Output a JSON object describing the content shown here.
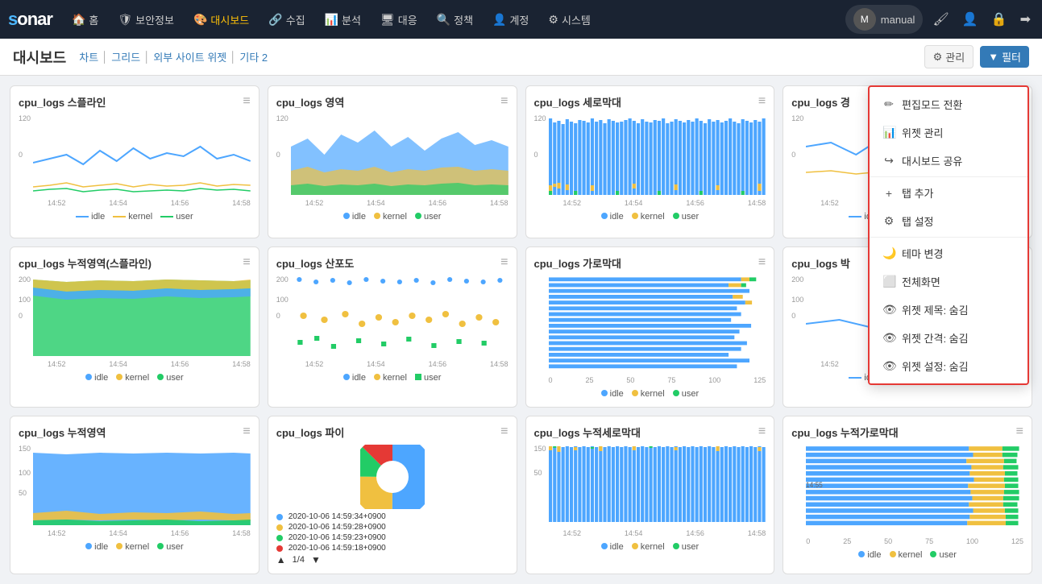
{
  "app": {
    "logo_s": "s",
    "logo_rest": "onar"
  },
  "nav": {
    "items": [
      {
        "id": "home",
        "icon": "🏠",
        "label": "홈"
      },
      {
        "id": "security",
        "icon": "🛡",
        "label": "보안정보"
      },
      {
        "id": "dashboard",
        "icon": "🎨",
        "label": "대시보드",
        "active": true
      },
      {
        "id": "collect",
        "icon": "🔗",
        "label": "수집"
      },
      {
        "id": "analysis",
        "icon": "📊",
        "label": "분석"
      },
      {
        "id": "response",
        "icon": "🖥",
        "label": "대응"
      },
      {
        "id": "policy",
        "icon": "🔍",
        "label": "정책"
      },
      {
        "id": "account",
        "icon": "👤",
        "label": "계정"
      },
      {
        "id": "system",
        "icon": "⚙",
        "label": "시스템"
      }
    ],
    "user": "manual"
  },
  "page": {
    "title": "대시보드",
    "tabs": [
      {
        "label": "차트",
        "id": "chart"
      },
      {
        "label": "그리드",
        "id": "grid"
      },
      {
        "label": "외부 사이트 위젯",
        "id": "external"
      },
      {
        "label": "기타 2",
        "id": "other"
      }
    ],
    "manage_label": "관리",
    "filter_label": "필터"
  },
  "dropdown": {
    "items": [
      {
        "icon": "✏",
        "label": "편집모드 전환",
        "id": "edit-mode"
      },
      {
        "icon": "📊",
        "label": "위젯 관리",
        "id": "widget-manage"
      },
      {
        "icon": "↪",
        "label": "대시보드 공유",
        "id": "dashboard-share"
      },
      {
        "divider": true
      },
      {
        "icon": "+",
        "label": "탭 추가",
        "id": "tab-add"
      },
      {
        "icon": "⚙",
        "label": "탭 설정",
        "id": "tab-settings"
      },
      {
        "divider": true
      },
      {
        "icon": "🌙",
        "label": "테마 변경",
        "id": "theme-change"
      },
      {
        "icon": "⬜",
        "label": "전체화면",
        "id": "fullscreen"
      },
      {
        "icon": "👁",
        "label": "위젯 제목: 숨김",
        "id": "widget-title-hide"
      },
      {
        "icon": "👁",
        "label": "위젯 간격: 숨김",
        "id": "widget-gap-hide"
      },
      {
        "icon": "👁",
        "label": "위젯 설정: 숨김",
        "id": "widget-setting-hide"
      }
    ]
  },
  "widgets": {
    "row1": [
      {
        "id": "w1",
        "title": "cpu_logs 스플라인",
        "type": "spline"
      },
      {
        "id": "w2",
        "title": "cpu_logs 영역",
        "type": "area"
      },
      {
        "id": "w3",
        "title": "cpu_logs 세로막대",
        "type": "bar"
      },
      {
        "id": "w4",
        "title": "cpu_logs 경",
        "type": "spline2",
        "partial": true
      }
    ],
    "row2": [
      {
        "id": "w5",
        "title": "cpu_logs 누적영역(스플라인)",
        "type": "stackedSpline"
      },
      {
        "id": "w6",
        "title": "cpu_logs 산포도",
        "type": "scatter"
      },
      {
        "id": "w7",
        "title": "cpu_logs 가로막대",
        "type": "hbar"
      },
      {
        "id": "w8",
        "title": "cpu_logs 박",
        "type": "spline3",
        "partial": true
      }
    ],
    "row3": [
      {
        "id": "w9",
        "title": "cpu_logs 누적영역",
        "type": "stackedArea"
      },
      {
        "id": "w10",
        "title": "cpu_logs 파이",
        "type": "pie"
      },
      {
        "id": "w11",
        "title": "cpu_logs 누적세로막대",
        "type": "stackedBar"
      },
      {
        "id": "w12",
        "title": "cpu_logs 누적가로막대",
        "type": "stackedHBar"
      }
    ]
  },
  "legend": {
    "idle_color": "#4da6ff",
    "kernel_color": "#f0c040",
    "user_color": "#22cc66",
    "idle_label": "idle",
    "kernel_label": "kernel",
    "user_label": "user"
  },
  "xaxis": {
    "labels": [
      "14:52",
      "14:54",
      "14:56",
      "14:58"
    ]
  },
  "pie": {
    "entries": [
      {
        "color": "#4da6ff",
        "label": "2020-10-06 14:59:34+0900"
      },
      {
        "color": "#f0c040",
        "label": "2020-10-06 14:59:28+0900"
      },
      {
        "color": "#22cc66",
        "label": "2020-10-06 14:59:23+0900"
      },
      {
        "color": "#e53935",
        "label": "2020-10-06 14:59:18+0900"
      }
    ],
    "page": "1/4"
  }
}
